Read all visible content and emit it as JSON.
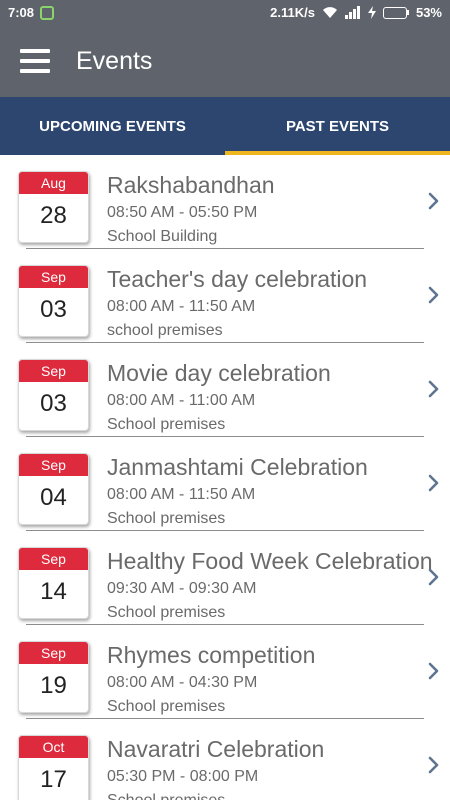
{
  "status_bar": {
    "time": "7:08",
    "speed": "2.11K/s",
    "battery": "53%",
    "battery_level": 0.53
  },
  "app_bar": {
    "title": "Events"
  },
  "tabs": [
    {
      "label": "UPCOMING EVENTS",
      "active": false
    },
    {
      "label": "PAST EVENTS",
      "active": true
    }
  ],
  "events": [
    {
      "month": "Aug",
      "day": "28",
      "title": "Rakshabandhan",
      "time": "08:50 AM - 05:50 PM",
      "place": "School Building"
    },
    {
      "month": "Sep",
      "day": "03",
      "title": "Teacher's day celebration",
      "time": "08:00 AM - 11:50 AM",
      "place": "school premises"
    },
    {
      "month": "Sep",
      "day": "03",
      "title": "Movie day celebration",
      "time": "08:00 AM - 11:00 AM",
      "place": "School premises"
    },
    {
      "month": "Sep",
      "day": "04",
      "title": "Janmashtami Celebration",
      "time": "08:00 AM - 11:50 AM",
      "place": "School premises"
    },
    {
      "month": "Sep",
      "day": "14",
      "title": "Healthy Food Week Celebration",
      "time": "09:30 AM - 09:30 AM",
      "place": "School premises"
    },
    {
      "month": "Sep",
      "day": "19",
      "title": "Rhymes competition",
      "time": "08:00 AM - 04:30 PM",
      "place": "School premises"
    },
    {
      "month": "Oct",
      "day": "17",
      "title": "Navaratri Celebration",
      "time": "05:30 PM - 08:00 PM",
      "place": "School premises"
    }
  ],
  "icons": {
    "menu": "hamburger-menu-icon",
    "row": "chevron-right-icon",
    "calendar": "calendar-icon"
  },
  "colors": {
    "app_bar": "#5f636b",
    "tab_bar": "#2d4670",
    "tab_indicator": "#f0b61f",
    "calendar_header": "#de2a3d"
  }
}
